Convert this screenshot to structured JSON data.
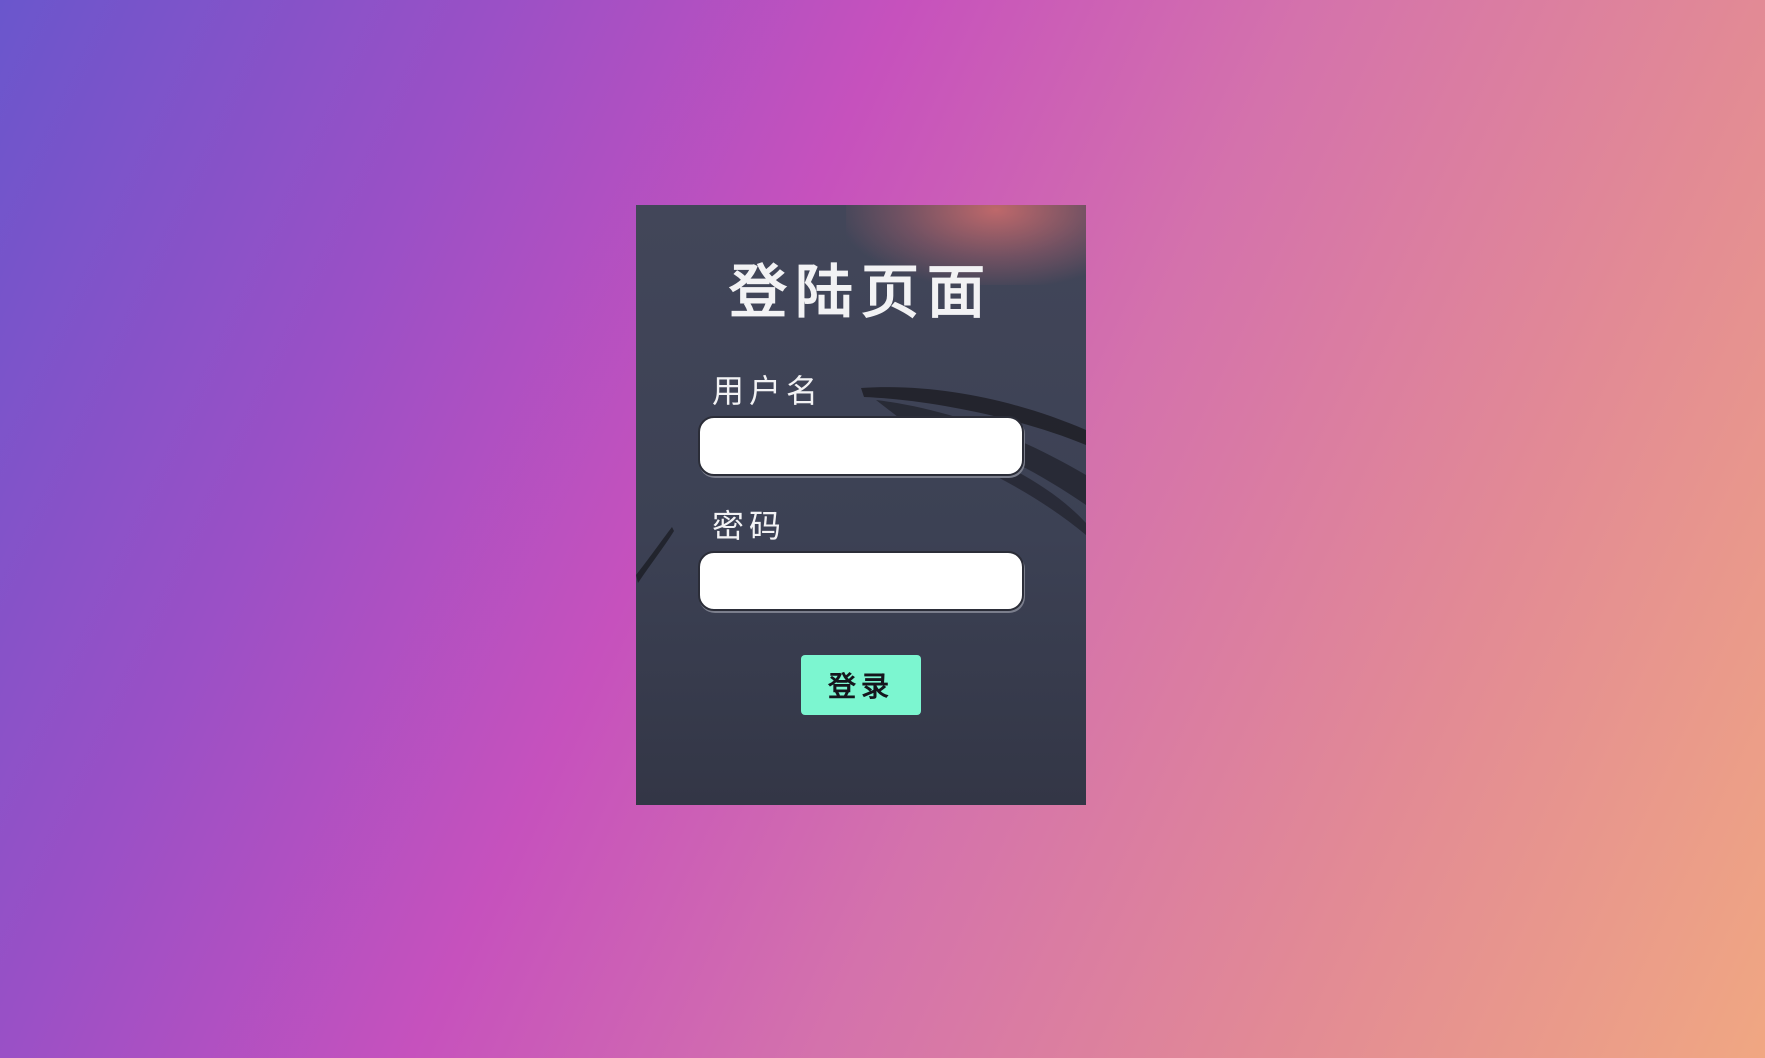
{
  "login_card": {
    "title": "登陆页面",
    "username_label": "用户名",
    "username_value": "",
    "password_label": "密码",
    "password_value": "",
    "submit_label": "登录"
  },
  "colors": {
    "background_start": "#6a56cc",
    "background_mid": "#c651bd",
    "background_end": "#f0a782",
    "card": "#3c4154",
    "button": "#7cf6d0"
  }
}
